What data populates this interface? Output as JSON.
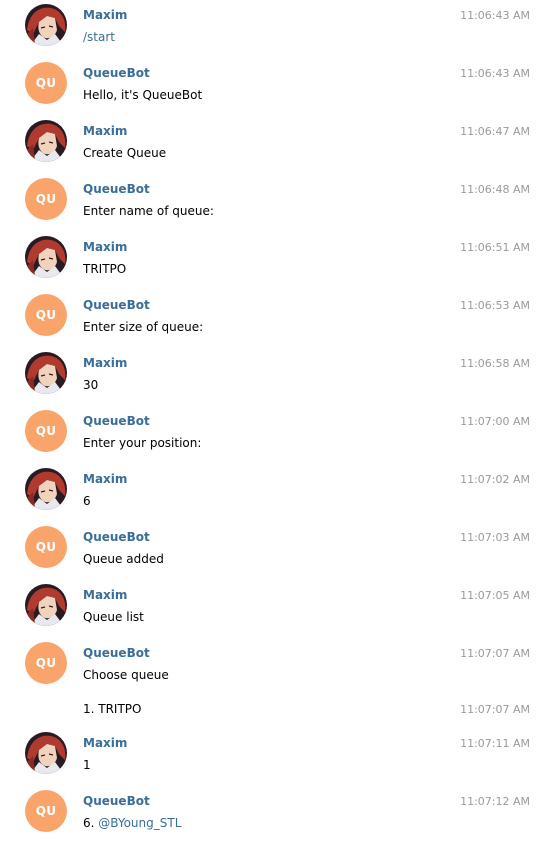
{
  "chat": {
    "user_name": "Maxim",
    "bot_name": "QueueBot",
    "bot_initials": "QU",
    "colors": {
      "name": "#3a6d99",
      "bot_avatar": "#f9a46b",
      "timestamp": "#9a9a9a",
      "link": "#3a6d99"
    },
    "messages": [
      {
        "sender": "Maxim",
        "time": "11:06:43 AM",
        "text": "/start"
      },
      {
        "sender": "QueueBot",
        "time": "11:06:43 AM",
        "text": "Hello, it's QueueBot"
      },
      {
        "sender": "Maxim",
        "time": "11:06:47 AM",
        "text": "Create Queue"
      },
      {
        "sender": "QueueBot",
        "time": "11:06:48 AM",
        "text": "Enter name of queue:"
      },
      {
        "sender": "Maxim",
        "time": "11:06:51 AM",
        "text": "TRITPO"
      },
      {
        "sender": "QueueBot",
        "time": "11:06:53 AM",
        "text": "Enter size of queue:"
      },
      {
        "sender": "Maxim",
        "time": "11:06:58 AM",
        "text": "30"
      },
      {
        "sender": "QueueBot",
        "time": "11:07:00 AM",
        "text": "Enter your position:"
      },
      {
        "sender": "Maxim",
        "time": "11:07:02 AM",
        "text": "6"
      },
      {
        "sender": "QueueBot",
        "time": "11:07:03 AM",
        "text": "Queue added"
      },
      {
        "sender": "Maxim",
        "time": "11:07:05 AM",
        "text": "Queue list"
      },
      {
        "sender": "QueueBot",
        "time": "11:07:07 AM",
        "text": "Choose queue"
      },
      {
        "sender": "QueueBot",
        "time": "11:07:07 AM",
        "text": "1. TRITPO"
      },
      {
        "sender": "Maxim",
        "time": "11:07:11 AM",
        "text": "1"
      },
      {
        "sender": "QueueBot",
        "time": "11:07:12 AM",
        "text_prefix": "6. ",
        "mention": "@BYoung_STL"
      }
    ]
  }
}
